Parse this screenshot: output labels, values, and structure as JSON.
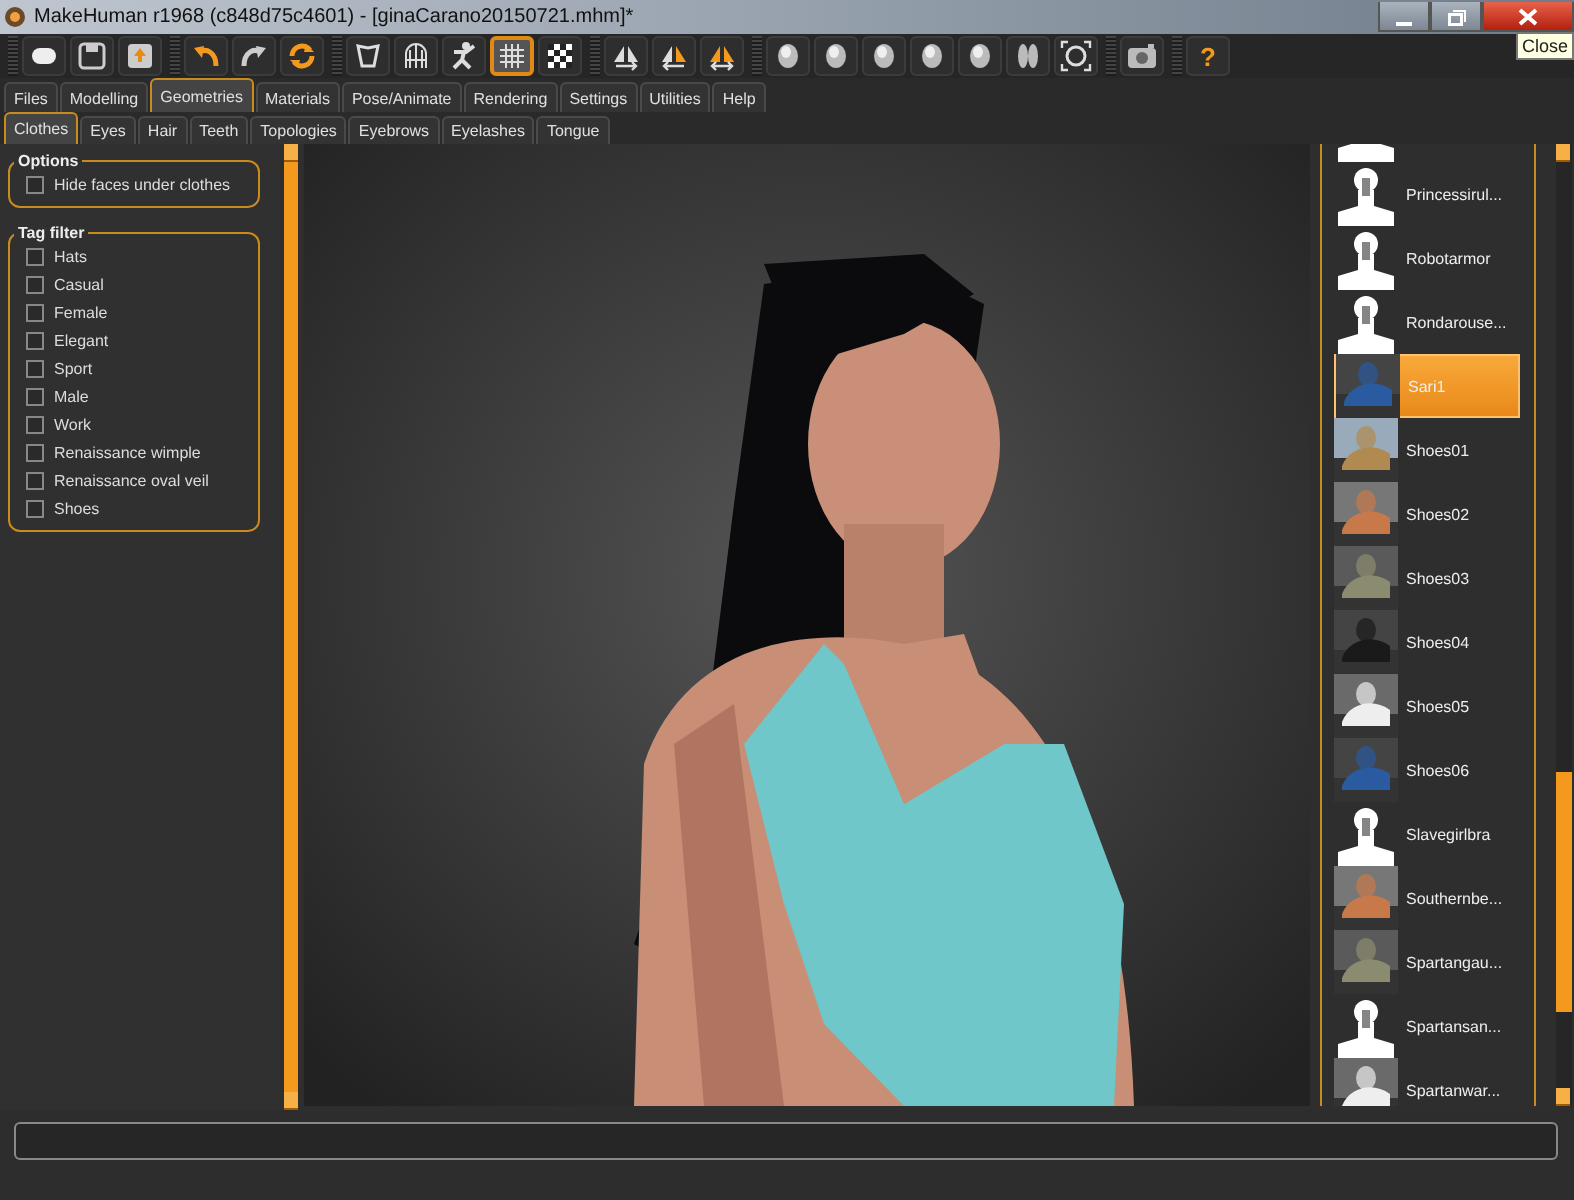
{
  "window": {
    "title": "MakeHuman r1968 (c848d75c4601) - [ginaCarano20150721.mhm]*",
    "tooltip": "Close"
  },
  "toolbar": [
    [
      {
        "kind": "new",
        "selected": false
      },
      {
        "kind": "save",
        "selected": false
      },
      {
        "kind": "export",
        "selected": false
      }
    ],
    [
      {
        "kind": "undo",
        "selected": false
      },
      {
        "kind": "redo",
        "selected": false
      },
      {
        "kind": "reset",
        "selected": false
      }
    ],
    [
      {
        "kind": "smooth",
        "selected": false
      },
      {
        "kind": "wireframe",
        "selected": false
      },
      {
        "kind": "pose",
        "selected": false
      },
      {
        "kind": "grid",
        "selected": true
      },
      {
        "kind": "checker",
        "selected": false
      }
    ],
    [
      {
        "kind": "sym-right",
        "selected": false
      },
      {
        "kind": "sym-left",
        "selected": false
      },
      {
        "kind": "sym",
        "selected": false
      }
    ],
    [
      {
        "kind": "head",
        "selected": false
      },
      {
        "kind": "head",
        "selected": false
      },
      {
        "kind": "head",
        "selected": false
      },
      {
        "kind": "head",
        "selected": false
      },
      {
        "kind": "head",
        "selected": false
      },
      {
        "kind": "feet",
        "selected": false
      },
      {
        "kind": "frame",
        "selected": false
      }
    ],
    [
      {
        "kind": "camera",
        "selected": false
      }
    ],
    [
      {
        "kind": "help",
        "label": "?",
        "selected": false
      }
    ]
  ],
  "tabs": [
    {
      "label": "Files",
      "selected": false
    },
    {
      "label": "Modelling",
      "selected": false
    },
    {
      "label": "Geometries",
      "selected": true
    },
    {
      "label": "Materials",
      "selected": false
    },
    {
      "label": "Pose/Animate",
      "selected": false
    },
    {
      "label": "Rendering",
      "selected": false
    },
    {
      "label": "Settings",
      "selected": false
    },
    {
      "label": "Utilities",
      "selected": false
    },
    {
      "label": "Help",
      "selected": false
    }
  ],
  "subtabs": [
    {
      "label": "Clothes",
      "selected": true
    },
    {
      "label": "Eyes",
      "selected": false
    },
    {
      "label": "Hair",
      "selected": false
    },
    {
      "label": "Teeth",
      "selected": false
    },
    {
      "label": "Topologies",
      "selected": false
    },
    {
      "label": "Eyebrows",
      "selected": false
    },
    {
      "label": "Eyelashes",
      "selected": false
    },
    {
      "label": "Tongue",
      "selected": false
    }
  ],
  "options": {
    "title": "Options",
    "items": [
      {
        "label": "Hide faces under clothes",
        "checked": false
      }
    ]
  },
  "tag_filter": {
    "title": "Tag filter",
    "items": [
      {
        "label": "Hats",
        "checked": false
      },
      {
        "label": "Casual",
        "checked": false
      },
      {
        "label": "Female",
        "checked": false
      },
      {
        "label": "Elegant",
        "checked": false
      },
      {
        "label": "Sport",
        "checked": false
      },
      {
        "label": "Male",
        "checked": false
      },
      {
        "label": "Work",
        "checked": false
      },
      {
        "label": "Renaissance wimple",
        "checked": false
      },
      {
        "label": "Renaissance oval veil",
        "checked": false
      },
      {
        "label": "Shoes",
        "checked": false
      }
    ]
  },
  "library": {
    "items": [
      {
        "kind": "silhouette",
        "selected": false
      },
      {
        "kind": "silhouette",
        "label": "Princessirul...",
        "selected": false
      },
      {
        "kind": "silhouette",
        "label": "Robotarmor",
        "selected": false
      },
      {
        "kind": "silhouette",
        "label": "Rondarouse...",
        "selected": false
      },
      {
        "kind": "picture",
        "label": "Sari1",
        "selected": true
      },
      {
        "kind": "picture",
        "label": "Shoes01",
        "selected": false
      },
      {
        "kind": "picture",
        "label": "Shoes02",
        "selected": false
      },
      {
        "kind": "picture",
        "label": "Shoes03",
        "selected": false
      },
      {
        "kind": "picture",
        "label": "Shoes04",
        "selected": false
      },
      {
        "kind": "picture",
        "label": "Shoes05",
        "selected": false
      },
      {
        "kind": "picture",
        "label": "Shoes06",
        "selected": false
      },
      {
        "kind": "silhouette",
        "label": "Slavegirlbra",
        "selected": false
      },
      {
        "kind": "picture",
        "label": "Southernbe...",
        "selected": false
      },
      {
        "kind": "picture",
        "label": "Spartangau...",
        "selected": false
      },
      {
        "kind": "silhouette",
        "label": "Spartansan...",
        "selected": false
      },
      {
        "kind": "picture",
        "label": "Spartanwar...",
        "selected": false
      }
    ]
  }
}
